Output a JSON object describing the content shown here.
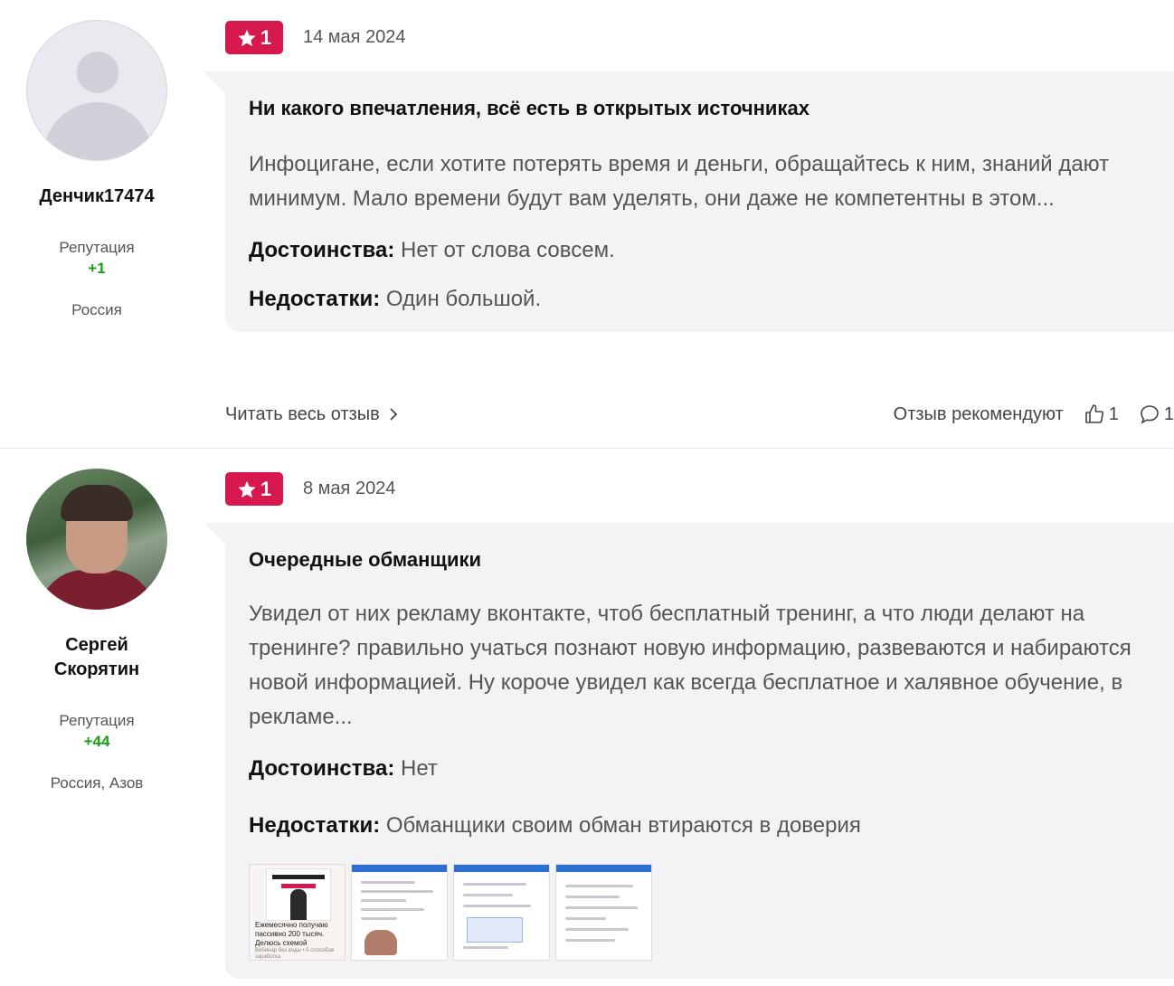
{
  "reviews": [
    {
      "author": {
        "name": "Денчик17474",
        "reputation_label": "Репутация",
        "reputation_value": "+1",
        "location": "Россия",
        "avatar": "default-avatar-icon"
      },
      "rating": "1",
      "date": "14 мая 2024",
      "title": "Ни какого впечатления, всё есть в открытых источниках",
      "text": "Инфоцигане, если хотите потерять время и деньги, обращайтесь к ним, знаний дают минимум. Мало времени будут вам уделять, они даже не компетентны в этом...",
      "pros_label": "Достоинства:",
      "pros": "Нет от слова совсем.",
      "cons_label": "Недостатки:",
      "cons": "Один большой.",
      "read_more": "Читать весь отзыв",
      "recommend_label": "Отзыв рекомендуют",
      "likes": "1",
      "comments": "1"
    },
    {
      "author": {
        "name": "Сергей Скорятин",
        "reputation_label": "Репутация",
        "reputation_value": "+44",
        "location": "Россия, Азов",
        "avatar": "user-photo"
      },
      "rating": "1",
      "date": "8 мая 2024",
      "title": "Очередные обманщики",
      "text": "Увидел от них рекламу вконтакте, чтоб бесплатный тренинг, а что люди делают на тренинге? правильно учаться познают новую информацию, развеваются и набираются новой информацией. Ну короче увидел как всегда бесплатное и халявное обучение, в рекламе...",
      "pros_label": "Достоинства:",
      "pros": "Нет",
      "cons_label": "Недостатки:",
      "cons": "Обманщики своим обман втираются в доверия",
      "thumbnails": [
        {
          "kind": "promo",
          "caption": "Ежемесячно получаю пассивно 200 тысяч. Делюсь схемой",
          "subcaption": "Вебинар без воды • 5 способов заработка"
        },
        {
          "kind": "screenshot"
        },
        {
          "kind": "screenshot"
        },
        {
          "kind": "screenshot"
        }
      ]
    }
  ],
  "colors": {
    "rating_badge": "#d6184f",
    "reputation": "#1a9e1a",
    "bubble_bg": "#f3f3f5"
  }
}
